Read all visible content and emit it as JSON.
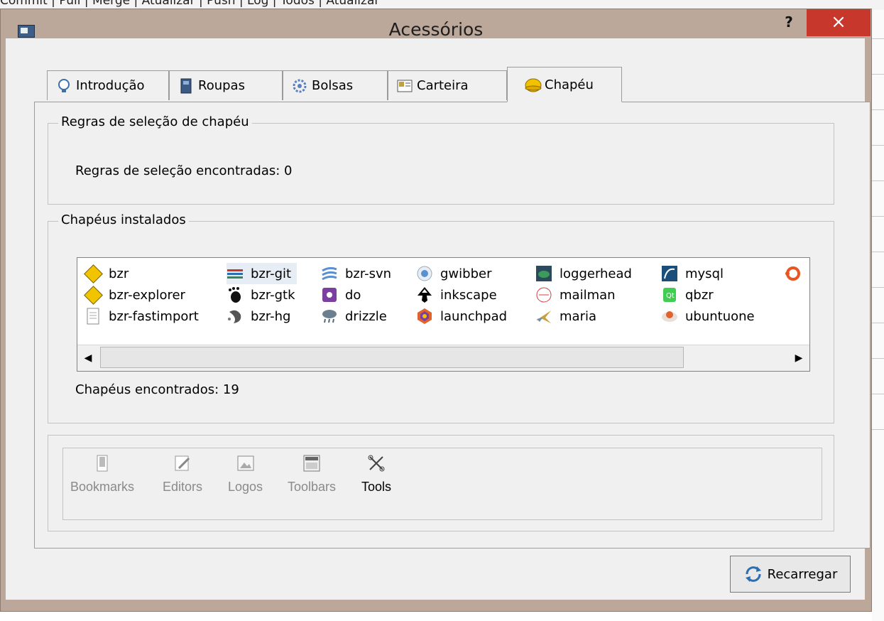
{
  "window": {
    "title": "Acessórios",
    "help": "?",
    "close": "×"
  },
  "tabs": [
    {
      "label": "Introdução",
      "icon": "lightbulb-icon"
    },
    {
      "label": "Roupas",
      "icon": "shirt-icon"
    },
    {
      "label": "Bolsas",
      "icon": "gear-icon"
    },
    {
      "label": "Carteira",
      "icon": "wallet-icon"
    },
    {
      "label": "Chapéu",
      "icon": "hat-icon",
      "active": true
    }
  ],
  "rules_group": {
    "title": "Regras de seleção de chapéu",
    "found_text": "Regras de seleção encontradas: 0"
  },
  "installed_group": {
    "title": "Chapéus instalados",
    "found_text": "Chapéus encontrados: 19"
  },
  "hats": [
    {
      "label": "bzr",
      "icon": "bzr-icon"
    },
    {
      "label": "bzr-explorer",
      "icon": "bzr-icon"
    },
    {
      "label": "bzr-fastimport",
      "icon": "document-icon"
    },
    {
      "label": "bzr-git",
      "icon": "git-icon"
    },
    {
      "label": "bzr-gtk",
      "icon": "gnome-foot-icon"
    },
    {
      "label": "bzr-hg",
      "icon": "mercurial-icon"
    },
    {
      "label": "bzr-svn",
      "icon": "svn-icon"
    },
    {
      "label": "do",
      "icon": "do-icon"
    },
    {
      "label": "drizzle",
      "icon": "drizzle-icon"
    },
    {
      "label": "gwibber",
      "icon": "gwibber-icon"
    },
    {
      "label": "inkscape",
      "icon": "inkscape-icon"
    },
    {
      "label": "launchpad",
      "icon": "launchpad-icon"
    },
    {
      "label": "loggerhead",
      "icon": "loggerhead-icon"
    },
    {
      "label": "mailman",
      "icon": "mailman-icon"
    },
    {
      "label": "maria",
      "icon": "maria-icon"
    },
    {
      "label": "mysql",
      "icon": "mysql-icon"
    },
    {
      "label": "qbzr",
      "icon": "qt-icon"
    },
    {
      "label": "ubuntuone",
      "icon": "ubuntuone-icon"
    }
  ],
  "toolbar": [
    {
      "label": "Bookmarks",
      "icon": "bookmark-icon"
    },
    {
      "label": "Editors",
      "icon": "editor-icon"
    },
    {
      "label": "Logos",
      "icon": "image-icon"
    },
    {
      "label": "Toolbars",
      "icon": "toolbar-icon"
    },
    {
      "label": "Tools",
      "icon": "tools-icon",
      "active": true
    }
  ],
  "reload_label": "Recarregar"
}
